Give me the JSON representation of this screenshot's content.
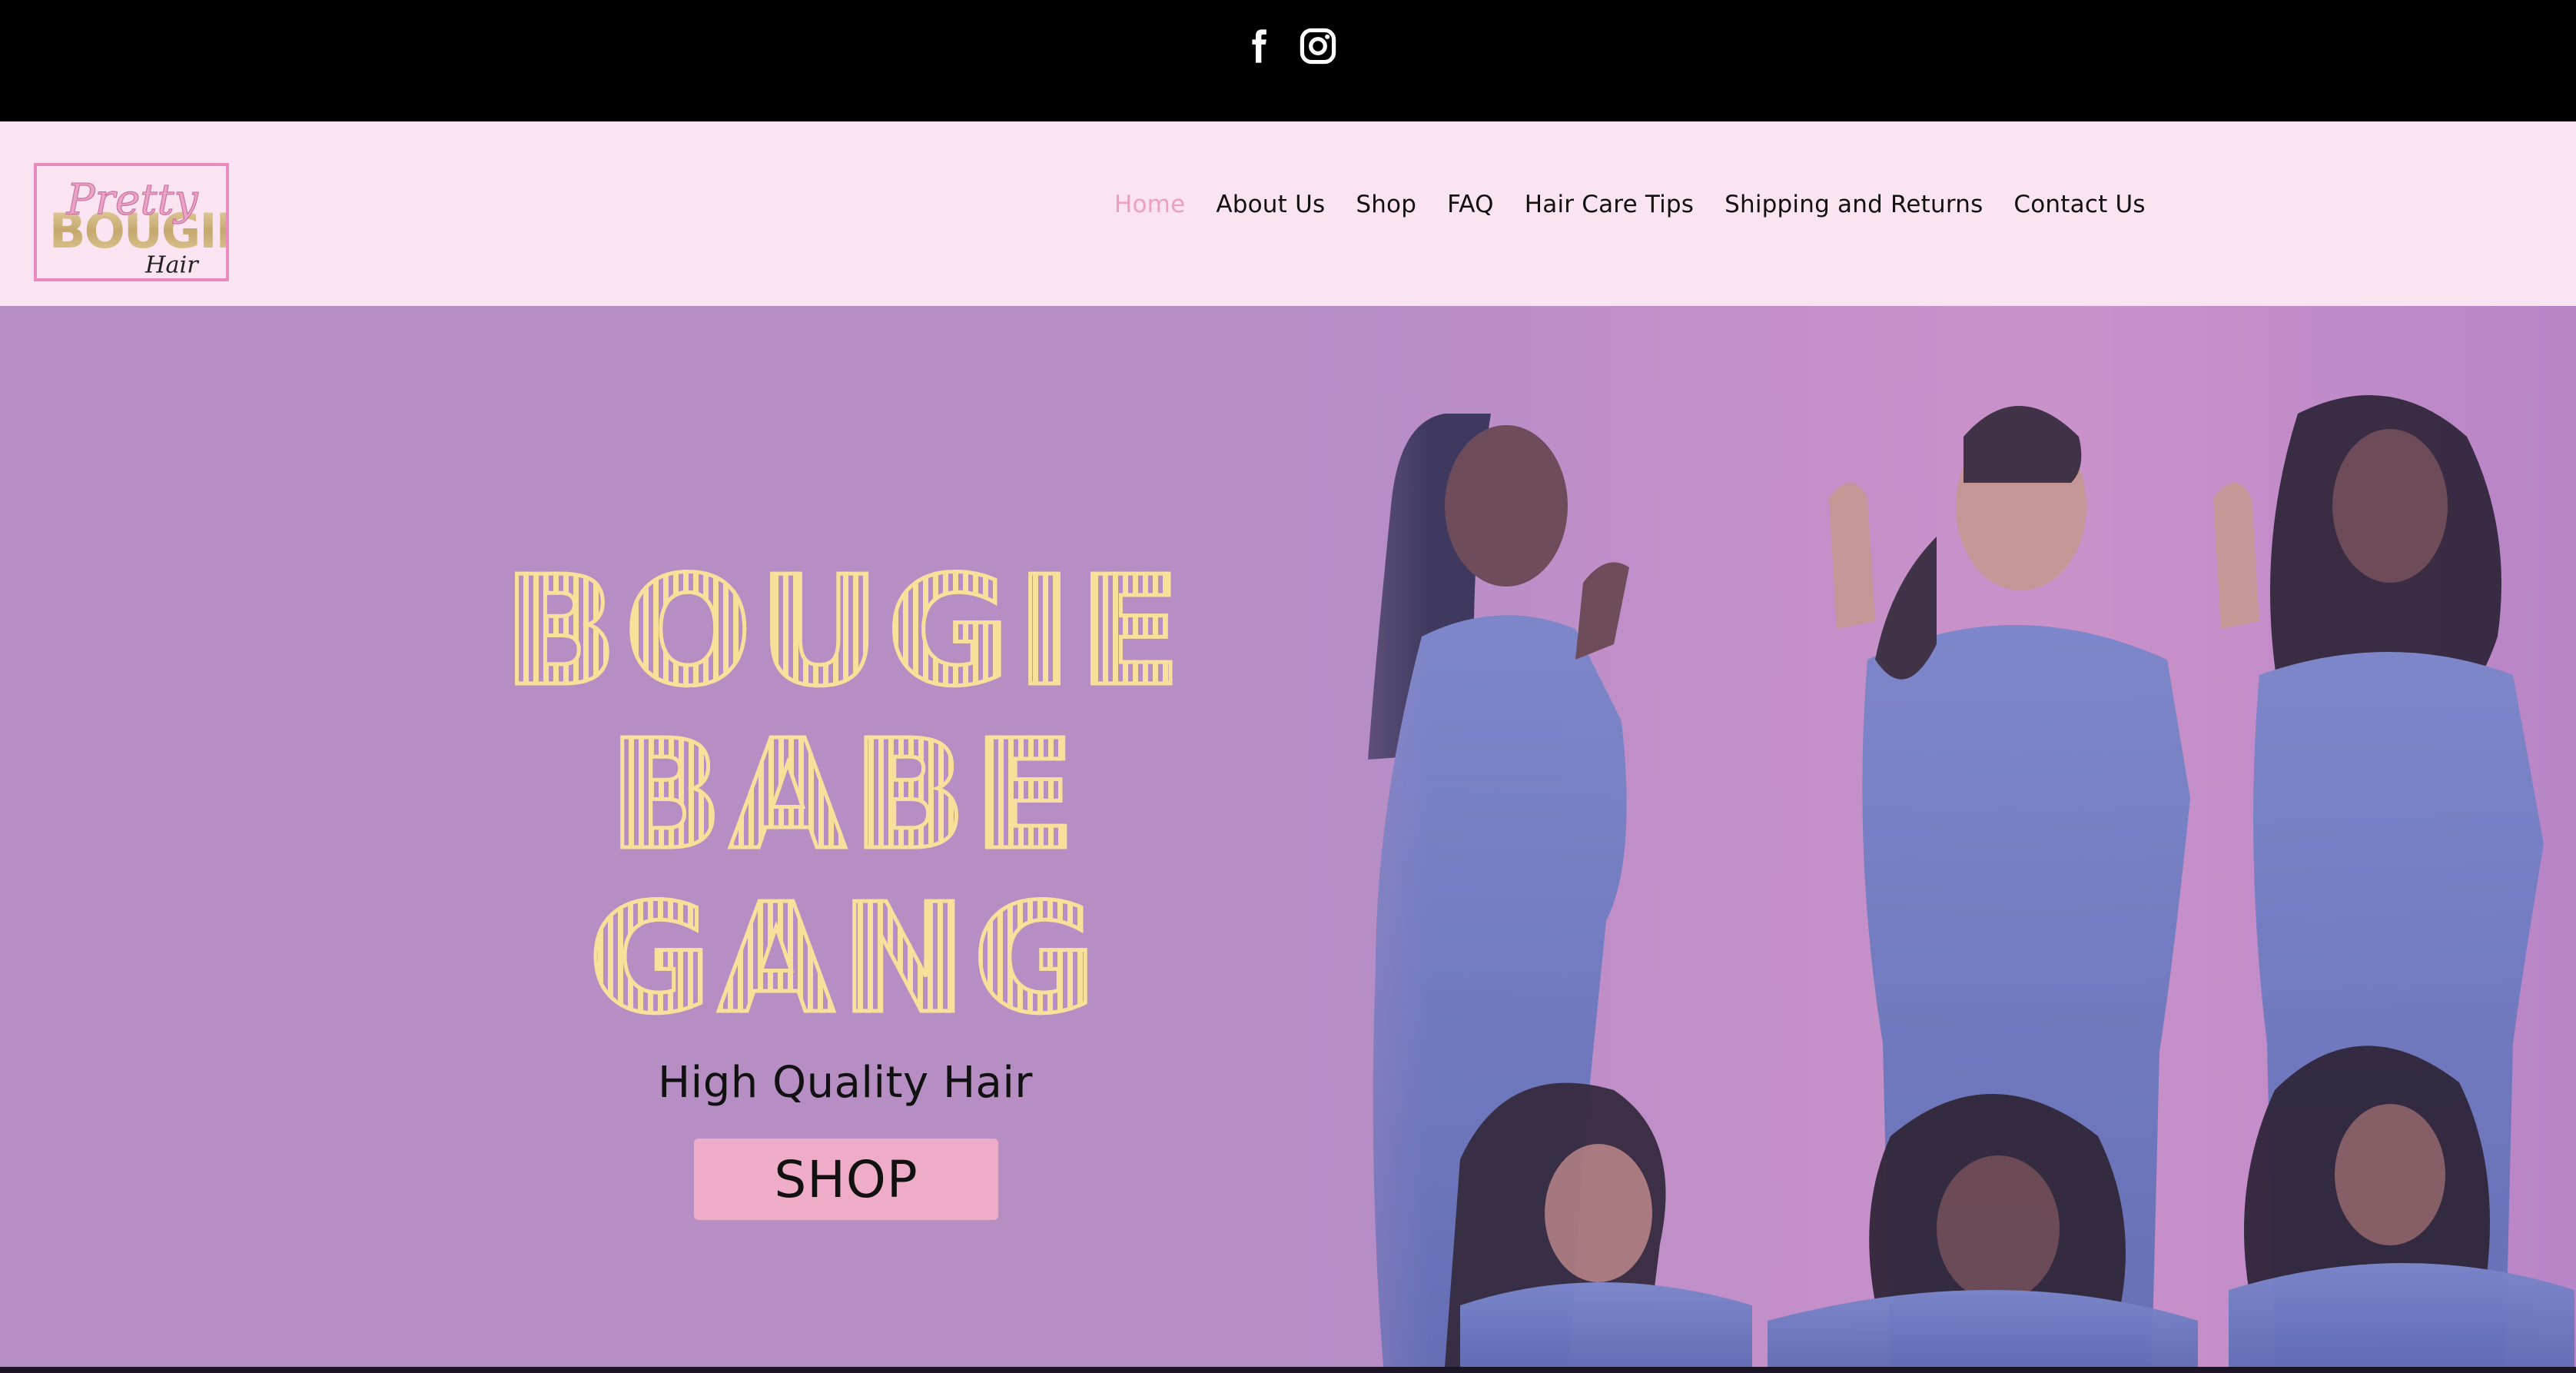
{
  "social": {
    "facebook_icon": "facebook-icon",
    "instagram_icon": "instagram-icon"
  },
  "logo": {
    "script_word": "Pretty",
    "main_word": "BOUGIE",
    "sub_word": "Hair"
  },
  "nav": {
    "items": [
      {
        "label": "Home",
        "active": true
      },
      {
        "label": "About Us",
        "active": false
      },
      {
        "label": "Shop",
        "active": false
      },
      {
        "label": "FAQ",
        "active": false
      },
      {
        "label": "Hair Care Tips",
        "active": false
      },
      {
        "label": "Shipping and Returns",
        "active": false
      },
      {
        "label": "Contact Us",
        "active": false
      }
    ]
  },
  "hero": {
    "title_lines": [
      "BOUGIE",
      "BABE",
      "GANG"
    ],
    "subtitle": "High Quality Hair",
    "cta_label": "SHOP"
  },
  "colors": {
    "topbar": "#000000",
    "header_bg": "#fbe4f1",
    "nav_active": "#ee9ec1",
    "hero_bg": "#b68ec4",
    "title": "#f8df9a",
    "cta_bg": "#eeacc9"
  }
}
